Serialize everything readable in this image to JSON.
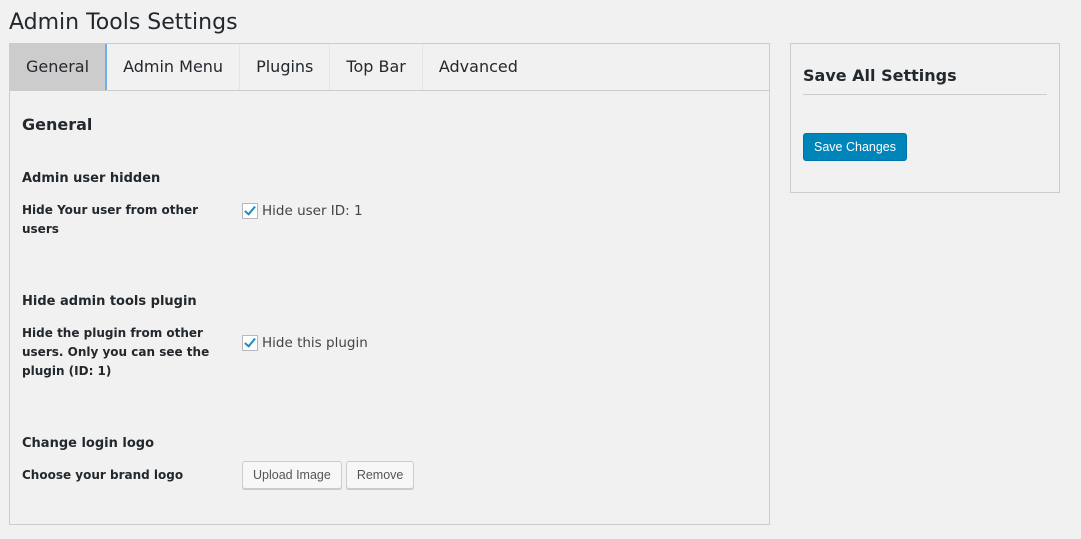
{
  "page_title": "Admin Tools Settings",
  "tabs": [
    {
      "label": "General"
    },
    {
      "label": "Admin Menu"
    },
    {
      "label": "Plugins"
    },
    {
      "label": "Top Bar"
    },
    {
      "label": "Advanced"
    }
  ],
  "section_title": "General",
  "sections": [
    {
      "heading": "Admin user hidden",
      "label": "Hide Your user from other users",
      "checkbox_label": "Hide user ID: 1",
      "checked": true
    },
    {
      "heading": "Hide admin tools plugin",
      "label": "Hide the plugin from other users. Only you can see the plugin (ID: 1)",
      "checkbox_label": "Hide this plugin",
      "checked": true
    },
    {
      "heading": "Change login logo",
      "label": "Choose your brand logo",
      "upload_label": "Upload Image",
      "remove_label": "Remove"
    }
  ],
  "sidebar": {
    "title": "Save All Settings",
    "save_label": "Save Changes"
  }
}
